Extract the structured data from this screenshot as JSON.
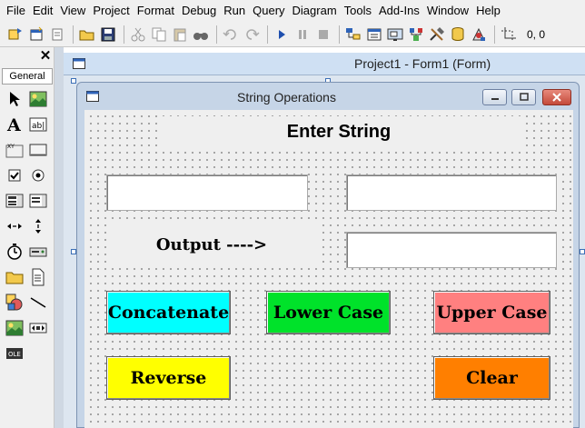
{
  "menu": [
    "File",
    "Edit",
    "View",
    "Project",
    "Format",
    "Debug",
    "Run",
    "Query",
    "Diagram",
    "Tools",
    "Add-Ins",
    "Window",
    "Help"
  ],
  "toolbar": {
    "coords": "0, 0"
  },
  "toolbox": {
    "tab_label": "General",
    "close_glyph": "✕"
  },
  "designer": {
    "title": "Project1 - Form1 (Form)"
  },
  "form": {
    "title": "String Operations",
    "heading": "Enter String",
    "output_label": "Output  ---->",
    "inputs": {
      "string1": "",
      "string2": "",
      "output": ""
    },
    "buttons": {
      "concatenate": "Concatenate",
      "lower_case": "Lower Case",
      "upper_case": "Upper Case",
      "reverse": "Reverse",
      "clear": "Clear"
    }
  },
  "colors": {
    "concatenate": "#00ffff",
    "lower_case": "#00e22a",
    "upper_case": "#ff8080",
    "reverse": "#ffff00",
    "clear": "#ff7f00"
  }
}
